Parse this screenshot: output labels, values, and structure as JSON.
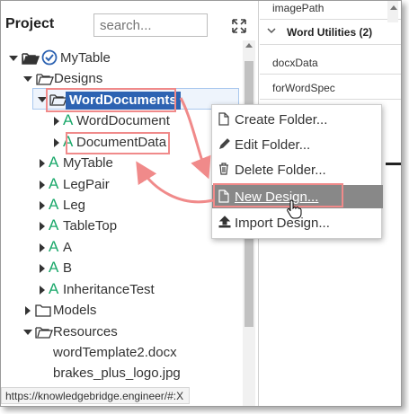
{
  "project_panel": {
    "title": "Project",
    "search_placeholder": "search..."
  },
  "tree": {
    "root": "MyTable",
    "designs": "Designs",
    "word_documents": "WordDocuments",
    "word_document": "WordDocument",
    "document_data": "DocumentData",
    "items": [
      "MyTable",
      "LegPair",
      "Leg",
      "TableTop",
      "A",
      "B",
      "InheritanceTest"
    ],
    "models": "Models",
    "resources": "Resources",
    "files": [
      "wordTemplate2.docx",
      "brakes_plus_logo.jpg"
    ]
  },
  "status_bar": {
    "url": "https://knowledgebridge.engineer/#:X"
  },
  "properties": {
    "image_path": "imagePath",
    "group": "Word Utilities (2)",
    "docx_data": "docxData",
    "for_word_spec": "forWordSpec"
  },
  "context_menu": {
    "items": [
      {
        "label": "Create Folder...",
        "icon": "file-icon"
      },
      {
        "label": "Edit Folder...",
        "icon": "pencil-icon"
      },
      {
        "label": "Delete Folder...",
        "icon": "trash-icon"
      },
      {
        "label": "New Design...",
        "icon": "file-icon"
      },
      {
        "label": "Import Design...",
        "icon": "upload-icon"
      }
    ]
  },
  "colors": {
    "selection": "#2d63b2",
    "annotation_red": "#f08a8a",
    "design_icon_green": "#1aa86a",
    "menu_highlight": "#888888"
  }
}
